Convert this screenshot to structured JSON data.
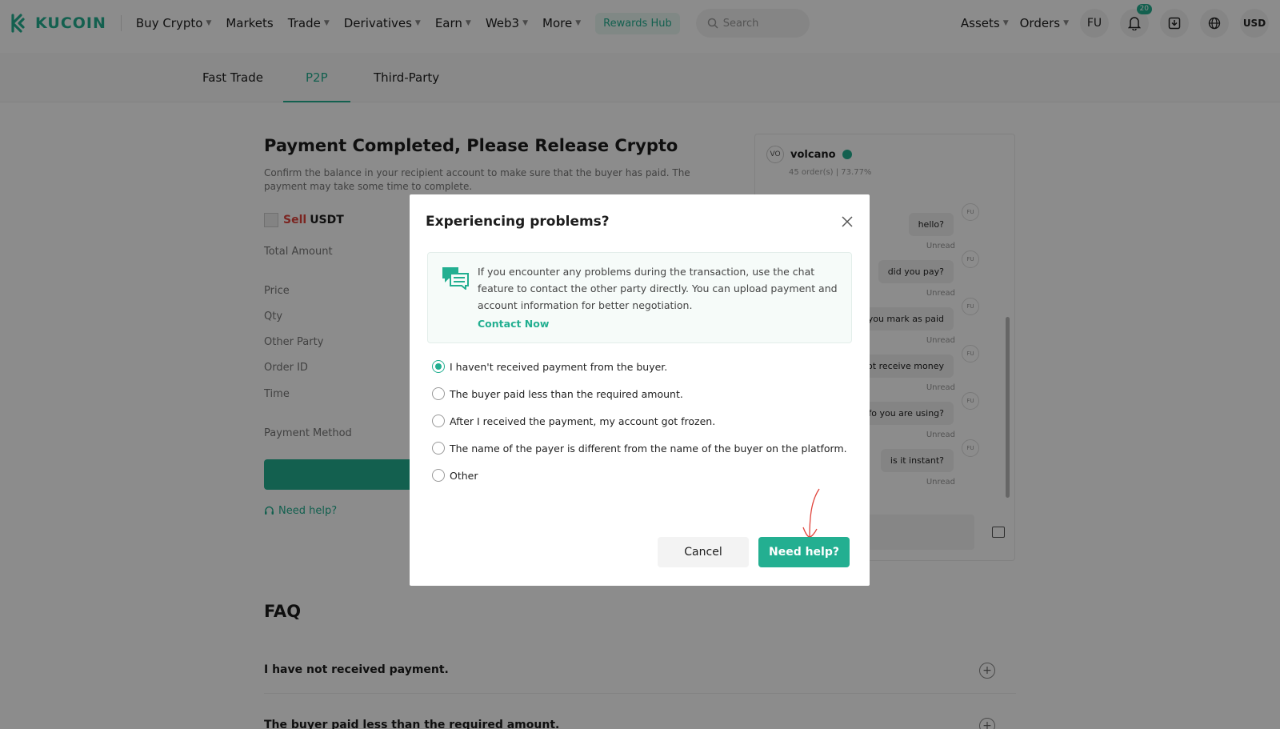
{
  "brand": {
    "name": "KUCOIN",
    "accent": "#23af91"
  },
  "nav": {
    "items": [
      {
        "label": "Buy Crypto",
        "caret": true
      },
      {
        "label": "Markets",
        "caret": false
      },
      {
        "label": "Trade",
        "caret": true
      },
      {
        "label": "Derivatives",
        "caret": true
      },
      {
        "label": "Earn",
        "caret": true
      },
      {
        "label": "Web3",
        "caret": true
      },
      {
        "label": "More",
        "caret": true
      }
    ],
    "rewards": "Rewards Hub",
    "search_placeholder": "Search",
    "assets": "Assets",
    "orders": "Orders",
    "avatar": "FU",
    "notifications_count": "20",
    "currency": "USD"
  },
  "subtabs": [
    "Fast Trade",
    "P2P",
    "Third-Party"
  ],
  "order": {
    "title": "Payment Completed, Please Release Crypto",
    "description": "Confirm the balance in your recipient account to make sure that the buyer has paid. The payment may take some time to complete.",
    "side": "Sell",
    "coin": "USDT",
    "fields": [
      "Total Amount",
      "Price",
      "Qty",
      "Other Party",
      "Order ID",
      "Time",
      "Payment Method"
    ],
    "need_help": "Need help?"
  },
  "chat": {
    "avatar": "VO",
    "name": "volcano",
    "stats": "45 order(s) | 73.77%",
    "messages": [
      {
        "text": "hello?",
        "status": "Unread",
        "badge": "FU"
      },
      {
        "text": "did you pay?",
        "status": "Unread",
        "badge": "FU"
      },
      {
        "text": "ee you mark as paid",
        "status": "Unread",
        "badge": "FU"
      },
      {
        "text": "d not receive money",
        "status": "Unread",
        "badge": "FU"
      },
      {
        "text": "t info you are using?",
        "status": "Unread",
        "badge": "FU"
      },
      {
        "text": "is it instant?",
        "status": "Unread",
        "badge": "FU"
      }
    ]
  },
  "faq": {
    "title": "FAQ",
    "questions": [
      "I have not received payment.",
      "The buyer paid less than the required amount."
    ]
  },
  "modal": {
    "title": "Experiencing problems?",
    "info": "If you encounter any problems during the transaction, use the chat feature to contact the other party directly. You can upload payment and account information for better negotiation.",
    "contact": "Contact Now",
    "options": [
      "I haven't received payment from the buyer.",
      "The buyer paid less than the required amount.",
      "After I received the payment, my account got frozen.",
      "The name of the payer is different from the name of the buyer on the platform.",
      "Other"
    ],
    "selected_option": 0,
    "cancel": "Cancel",
    "confirm": "Need help?"
  }
}
